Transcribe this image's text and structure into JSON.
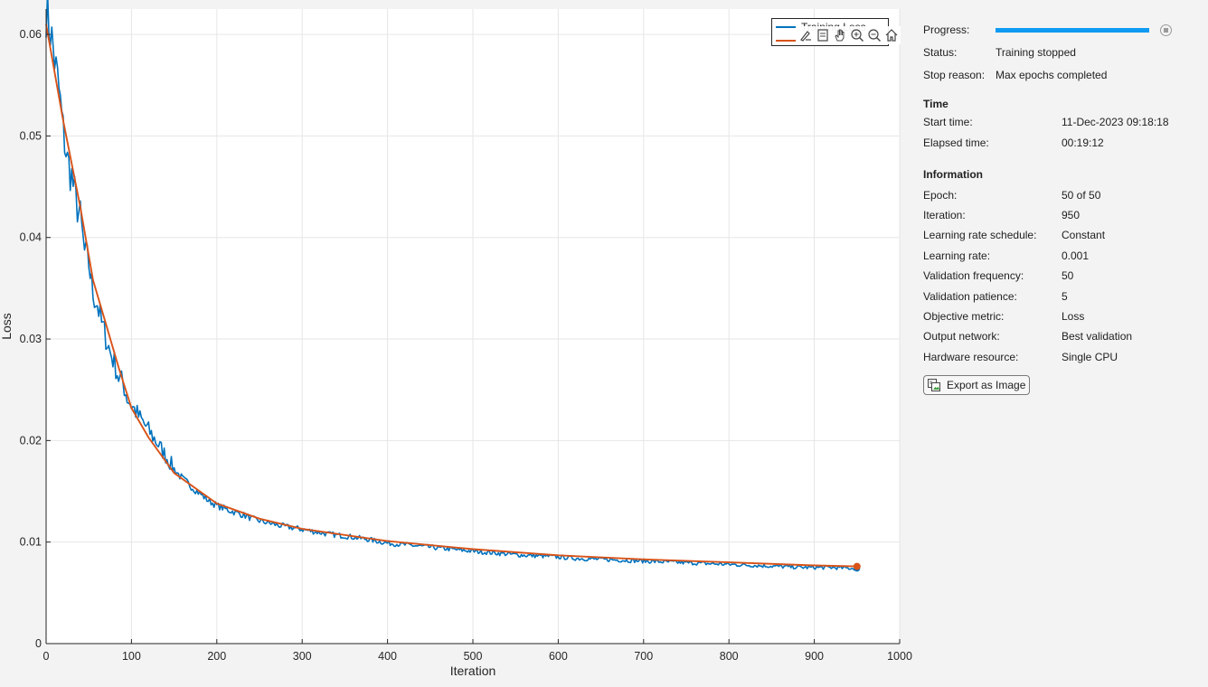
{
  "chart_data": {
    "type": "line",
    "xlabel": "Iteration",
    "ylabel": "Loss",
    "xlim": [
      0,
      1000
    ],
    "ylim": [
      0,
      0.0625
    ],
    "xticks": [
      0,
      100,
      200,
      300,
      400,
      500,
      600,
      700,
      800,
      900,
      1000
    ],
    "yticks": [
      0,
      0.01,
      0.02,
      0.03,
      0.04,
      0.05,
      0.06
    ],
    "ytick_labels": [
      "0",
      "0.01",
      "0.02",
      "0.03",
      "0.04",
      "0.05",
      "0.06"
    ],
    "grid": true,
    "legend_position": "top-right",
    "series": [
      {
        "name": "Training Loss",
        "color": "#0072bd",
        "x": [
          0,
          5,
          10,
          15,
          20,
          25,
          30,
          35,
          40,
          45,
          50,
          55,
          60,
          65,
          70,
          75,
          80,
          85,
          90,
          95,
          100,
          110,
          120,
          130,
          140,
          150,
          160,
          170,
          180,
          190,
          200,
          215,
          230,
          245,
          260,
          275,
          290,
          310,
          330,
          350,
          375,
          400,
          425,
          450,
          475,
          500,
          530,
          560,
          590,
          620,
          650,
          680,
          710,
          740,
          770,
          800,
          830,
          860,
          890,
          920,
          950
        ],
        "y": [
          0.0625,
          0.0605,
          0.0575,
          0.0545,
          0.0505,
          0.0475,
          0.046,
          0.0435,
          0.042,
          0.0385,
          0.0375,
          0.0345,
          0.0335,
          0.0315,
          0.0302,
          0.0287,
          0.0277,
          0.0262,
          0.0257,
          0.0242,
          0.0235,
          0.0222,
          0.021,
          0.0198,
          0.0185,
          0.0172,
          0.0162,
          0.0155,
          0.0148,
          0.0141,
          0.0136,
          0.0131,
          0.0127,
          0.0122,
          0.0119,
          0.0116,
          0.0114,
          0.0111,
          0.0108,
          0.0106,
          0.0103,
          0.0099,
          0.0097,
          0.0095,
          0.0093,
          0.0091,
          0.0089,
          0.0087,
          0.0086,
          0.0084,
          0.0083,
          0.0082,
          0.0081,
          0.008,
          0.0079,
          0.0078,
          0.0077,
          0.0076,
          0.0075,
          0.0075,
          0.0074
        ]
      },
      {
        "name": "Training Loss (smoothed)",
        "color": "#d95319",
        "x": [
          0,
          20,
          40,
          55,
          70,
          85,
          100,
          120,
          150,
          200,
          250,
          300,
          400,
          500,
          600,
          700,
          800,
          900,
          950
        ],
        "y": [
          0.061,
          0.0515,
          0.043,
          0.0358,
          0.0315,
          0.0272,
          0.0232,
          0.0203,
          0.0168,
          0.0138,
          0.0123,
          0.0113,
          0.0101,
          0.0093,
          0.0087,
          0.0083,
          0.008,
          0.0077,
          0.0076
        ]
      }
    ]
  },
  "legend": {
    "entry_1": "Training Loss"
  },
  "panel": {
    "progress_label": "Progress:",
    "progress_fraction": 1.0,
    "status_label": "Status:",
    "status_value": "Training stopped",
    "stop_reason_label": "Stop reason:",
    "stop_reason_value": "Max epochs completed",
    "time_title": "Time",
    "start_time_label": "Start time:",
    "start_time_value": "11-Dec-2023 09:18:18",
    "elapsed_label": "Elapsed time:",
    "elapsed_value": "00:19:12",
    "info_title": "Information",
    "epoch_label": "Epoch:",
    "epoch_value": "50 of 50",
    "iteration_label": "Iteration:",
    "iteration_value": "950",
    "lr_schedule_label": "Learning rate schedule:",
    "lr_schedule_value": "Constant",
    "lr_label": "Learning rate:",
    "lr_value": "0.001",
    "val_freq_label": "Validation frequency:",
    "val_freq_value": "50",
    "val_patience_label": "Validation patience:",
    "val_patience_value": "5",
    "objective_label": "Objective metric:",
    "objective_value": "Loss",
    "output_net_label": "Output network:",
    "output_net_value": "Best validation",
    "hardware_label": "Hardware resource:",
    "hardware_value": "Single CPU",
    "export_label": "Export as Image"
  },
  "colors": {
    "progress": "#0e9af1",
    "training_loss": "#0072bd",
    "smoothed": "#d95319"
  },
  "icons": [
    "brush-icon",
    "data-tips-icon",
    "pan-hand-icon",
    "zoom-in-icon",
    "zoom-out-icon",
    "home-icon",
    "stop-icon",
    "export-image-icon"
  ]
}
